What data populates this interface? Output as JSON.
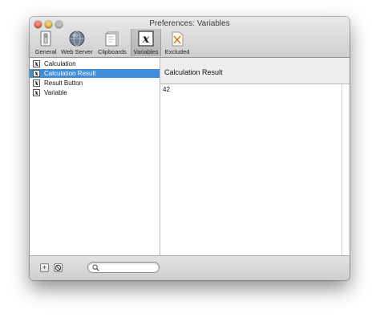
{
  "window": {
    "title": "Preferences: Variables"
  },
  "toolbar": {
    "items": [
      {
        "label": "General",
        "icon": "general-switch-icon"
      },
      {
        "label": "Web Server",
        "icon": "globe-icon"
      },
      {
        "label": "Clipboards",
        "icon": "clipboard-icon"
      },
      {
        "label": "Variables",
        "icon": "variable-x-icon",
        "selected": true
      },
      {
        "label": "Excluded",
        "icon": "excluded-document-icon"
      }
    ]
  },
  "sidebar": {
    "items": [
      {
        "label": "Calculation",
        "icon": "variable-x-icon"
      },
      {
        "label": "Calculation Result",
        "icon": "variable-x-icon",
        "selected": true
      },
      {
        "label": "Result Button",
        "icon": "variable-x-icon"
      },
      {
        "label": "Variable",
        "icon": "variable-x-icon"
      }
    ]
  },
  "detail": {
    "title": "Calculation Result",
    "value": "42"
  },
  "bottom": {
    "add_symbol": "+",
    "remove_icon": "no-entry-icon",
    "search_placeholder": "",
    "search_icon": "magnifier-icon"
  },
  "colors": {
    "selection": "#3f8edb",
    "close": "#d9412d",
    "minimize": "#d99d1e"
  }
}
